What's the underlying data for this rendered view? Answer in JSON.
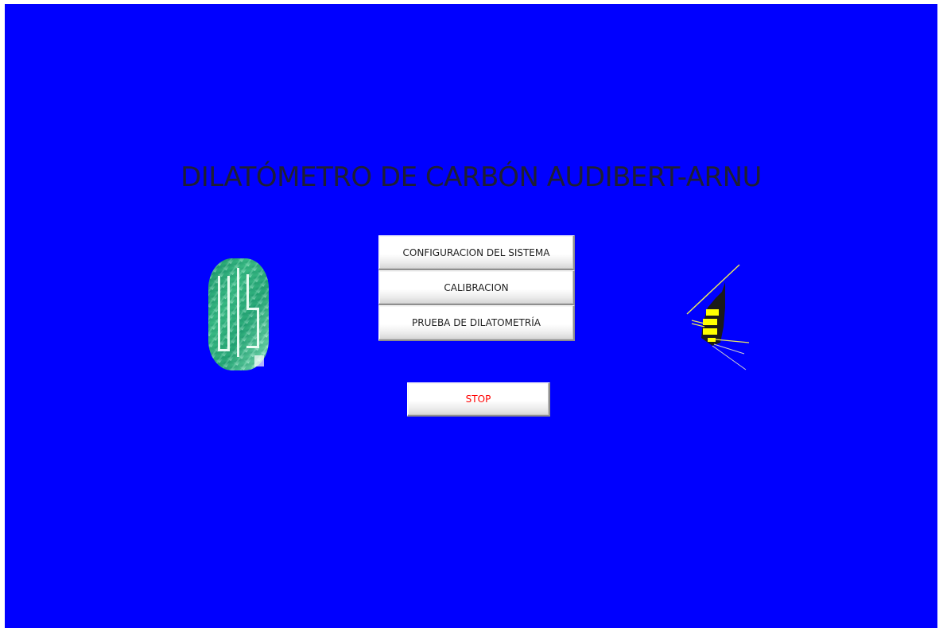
{
  "window": {
    "background_color": "#0000ff"
  },
  "header": {
    "title": "DILATÓMETRO DE CARBÓN AUDIBERT-ARNU"
  },
  "menu": {
    "config_label": "CONFIGURACION DEL SISTEMA",
    "calibration_label": "CALIBRACION",
    "dilatometry_label": "PRUEBA DE DILATOMETRÍA"
  },
  "controls": {
    "stop_label": "STOP",
    "stop_color": "#ff0000"
  },
  "logos": {
    "left_icon": "uis-university-logo-icon",
    "right_icon": "bee-logo-icon"
  }
}
